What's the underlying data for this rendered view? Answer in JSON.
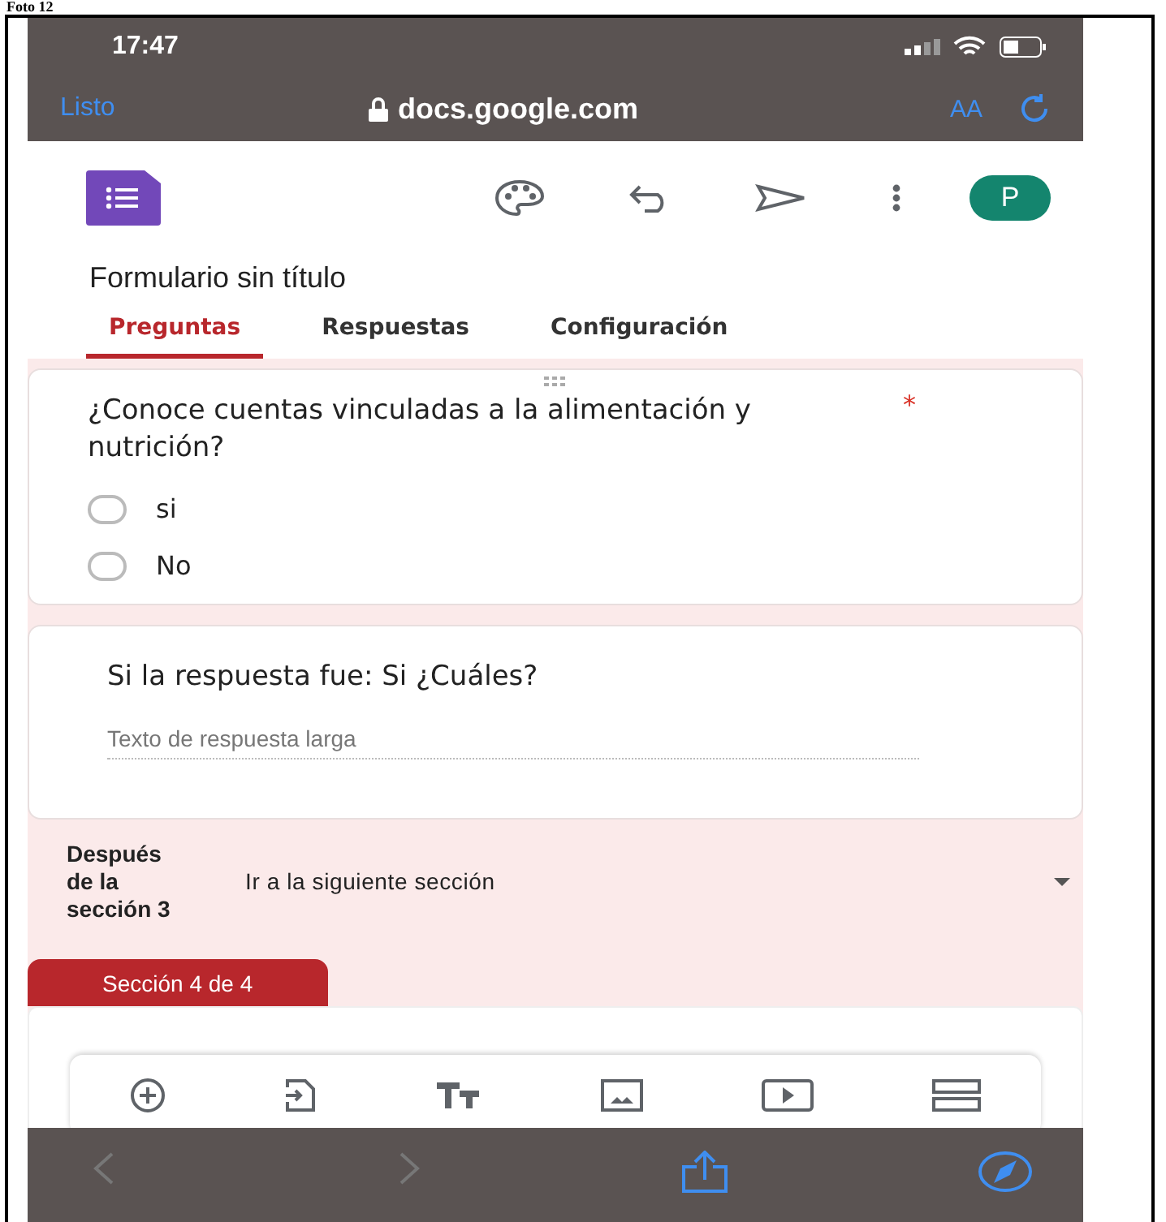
{
  "caption": "Foto 12",
  "status_bar": {
    "time": "17:47"
  },
  "browser": {
    "done": "Listo",
    "url": "docs.google.com",
    "text_size": "AA"
  },
  "app": {
    "avatar": "P"
  },
  "form_title": "Formulario sin título",
  "tabs": [
    {
      "label": "Preguntas",
      "selected": true
    },
    {
      "label": "Respuestas",
      "selected": false
    },
    {
      "label": "Configuración",
      "selected": false
    }
  ],
  "questions": [
    {
      "kind": "choice",
      "title": "¿Conoce cuentas vinculadas a la alimentación y nutrición?",
      "required_mark": "*",
      "options": [
        {
          "label": "si",
          "selected": false
        },
        {
          "label": "No",
          "selected": false
        }
      ]
    },
    {
      "kind": "paragraph",
      "title": "Si la respuesta fue: Si ¿Cuáles?",
      "placeholder": "Texto de respuesta larga"
    }
  ],
  "after_section": {
    "label": "Después de la sección 3",
    "value": "Ir a la siguiente sección"
  },
  "section_tab": "Sección 4 de 4"
}
